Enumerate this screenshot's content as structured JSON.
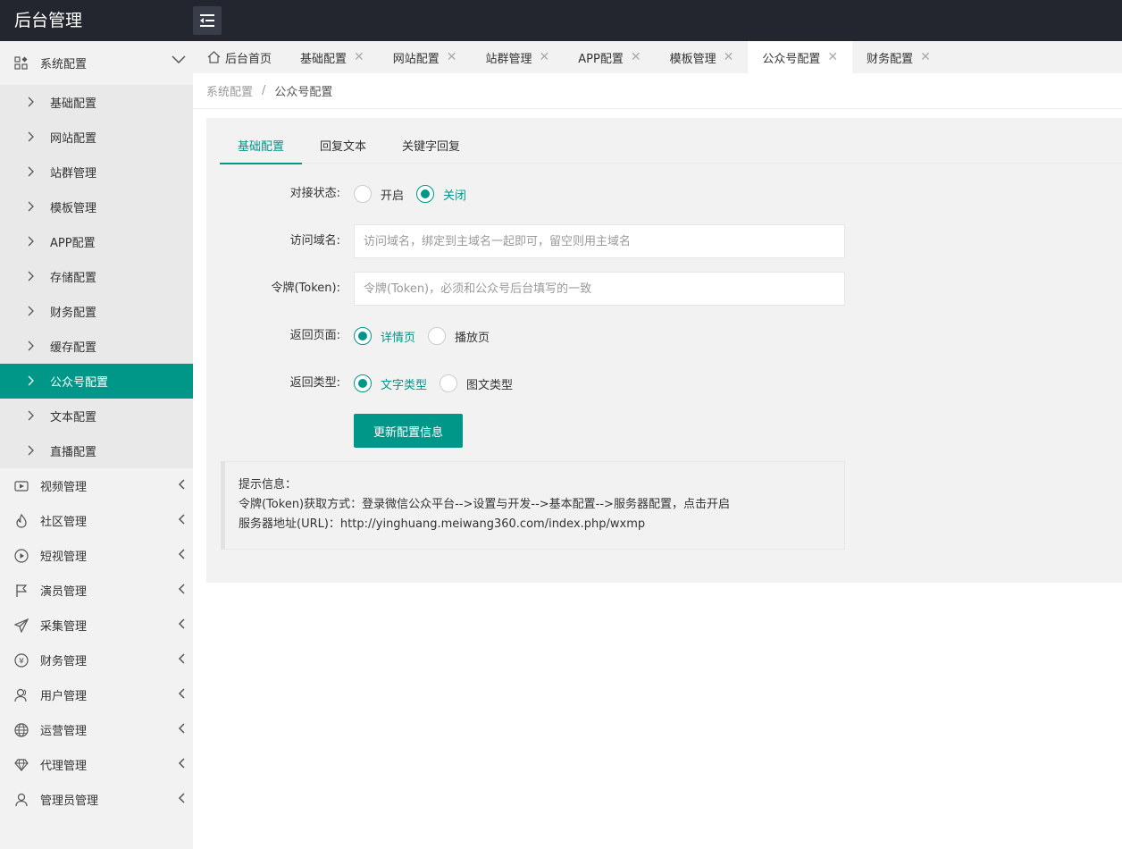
{
  "app": {
    "title": "后台管理"
  },
  "sidebar": {
    "group": {
      "label": "系统配置",
      "icon": "apps-icon",
      "items": [
        {
          "label": "基础配置",
          "active": false
        },
        {
          "label": "网站配置",
          "active": false
        },
        {
          "label": "站群管理",
          "active": false
        },
        {
          "label": "模板管理",
          "active": false
        },
        {
          "label": "APP配置",
          "active": false
        },
        {
          "label": "存储配置",
          "active": false
        },
        {
          "label": "财务配置",
          "active": false
        },
        {
          "label": "缓存配置",
          "active": false
        },
        {
          "label": "公众号配置",
          "active": true
        },
        {
          "label": "文本配置",
          "active": false
        },
        {
          "label": "直播配置",
          "active": false
        }
      ]
    },
    "menus": [
      {
        "label": "视频管理",
        "icon": "video-icon"
      },
      {
        "label": "社区管理",
        "icon": "fire-icon"
      },
      {
        "label": "短视管理",
        "icon": "play-circle-icon"
      },
      {
        "label": "演员管理",
        "icon": "flag-icon"
      },
      {
        "label": "采集管理",
        "icon": "send-icon"
      },
      {
        "label": "财务管理",
        "icon": "yen-icon"
      },
      {
        "label": "用户管理",
        "icon": "users-icon"
      },
      {
        "label": "运营管理",
        "icon": "globe-icon"
      },
      {
        "label": "代理管理",
        "icon": "diamond-icon"
      },
      {
        "label": "管理员管理",
        "icon": "user-icon"
      }
    ]
  },
  "tabs": [
    {
      "label": "后台首页",
      "home": true,
      "active": false
    },
    {
      "label": "基础配置",
      "active": false
    },
    {
      "label": "网站配置",
      "active": false
    },
    {
      "label": "站群管理",
      "active": false
    },
    {
      "label": "APP配置",
      "active": false
    },
    {
      "label": "模板管理",
      "active": false
    },
    {
      "label": "公众号配置",
      "active": true
    },
    {
      "label": "财务配置",
      "active": false
    }
  ],
  "tab_close_glyph": "✕",
  "breadcrumb": {
    "parent": "系统配置",
    "sep": "/",
    "current": "公众号配置"
  },
  "content_tabs": [
    {
      "label": "基础配置",
      "active": true
    },
    {
      "label": "回复文本",
      "active": false
    },
    {
      "label": "关键字回复",
      "active": false
    }
  ],
  "form": {
    "status": {
      "label": "对接状态:",
      "options": [
        "开启",
        "关闭"
      ],
      "selected": "关闭"
    },
    "domain": {
      "label": "访问域名:",
      "value": "",
      "placeholder": "访问域名，绑定到主域名一起即可，留空则用主域名"
    },
    "token": {
      "label": "令牌(Token):",
      "value": "",
      "placeholder": "令牌(Token)，必须和公众号后台填写的一致"
    },
    "return_page": {
      "label": "返回页面:",
      "options": [
        "详情页",
        "播放页"
      ],
      "selected": "详情页"
    },
    "return_type": {
      "label": "返回类型:",
      "options": [
        "文字类型",
        "图文类型"
      ],
      "selected": "文字类型"
    },
    "submit_label": "更新配置信息"
  },
  "tips": {
    "title": "提示信息：",
    "line1": "令牌(Token)获取方式：登录微信公众平台-->设置与开发-->基本配置-->服务器配置，点击开启",
    "line2": "服务器地址(URL)：http://yinghuang.meiwang360.com/index.php/wxmp"
  },
  "colors": {
    "accent": "#009688",
    "topbar": "#23262e",
    "sidebar": "#f2f2f2"
  }
}
